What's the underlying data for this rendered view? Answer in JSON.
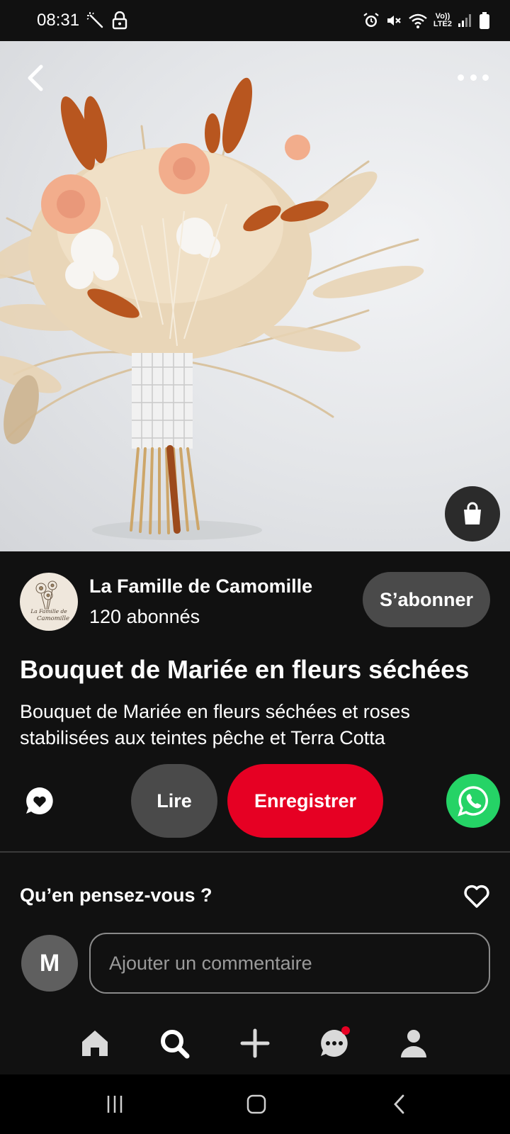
{
  "status_bar": {
    "time": "08:31",
    "left_icons": [
      "magic-wand-icon",
      "lock-icon"
    ],
    "right_icons": [
      "alarm-icon",
      "mute-icon",
      "wifi-icon",
      "signal-icon",
      "battery-icon"
    ],
    "network_line1": "Vo))",
    "network_line2": "LTE2"
  },
  "hero": {
    "image": "dried-flower-bridal-bouquet-photo",
    "back_icon": "back-arrow-icon",
    "more_icon": "more-dots-icon",
    "shop_icon": "shopping-bag-icon"
  },
  "creator": {
    "name": "La Famille de Camomille",
    "followers": "120 abonnés",
    "logo_text_1": "La Famille de",
    "logo_text_2": "Camomille",
    "subscribe_label": "S’abonner"
  },
  "pin": {
    "title": "Bouquet de Mariée en fleurs séchées",
    "description": "Bouquet de Mariée en fleurs séchées et roses stabilisées aux teintes pêche et Terra Cotta"
  },
  "actions": {
    "share_icon": "share-bubble-icon",
    "read_label": "Lire",
    "save_label": "Enregistrer",
    "whatsapp_icon": "whatsapp-icon"
  },
  "comments": {
    "title": "Qu’en pensez-vous ?",
    "heart_icon": "heart-icon",
    "user_initial": "M",
    "placeholder": "Ajouter un commentaire"
  },
  "bottom_nav": {
    "items": [
      "home-icon",
      "search-icon",
      "add-icon",
      "messages-icon",
      "profile-icon"
    ],
    "messages_has_notification": true
  },
  "colors": {
    "background": "#111111",
    "save_red": "#e60023",
    "button_gray": "#4a4a4a",
    "whatsapp_green": "#25d366"
  }
}
